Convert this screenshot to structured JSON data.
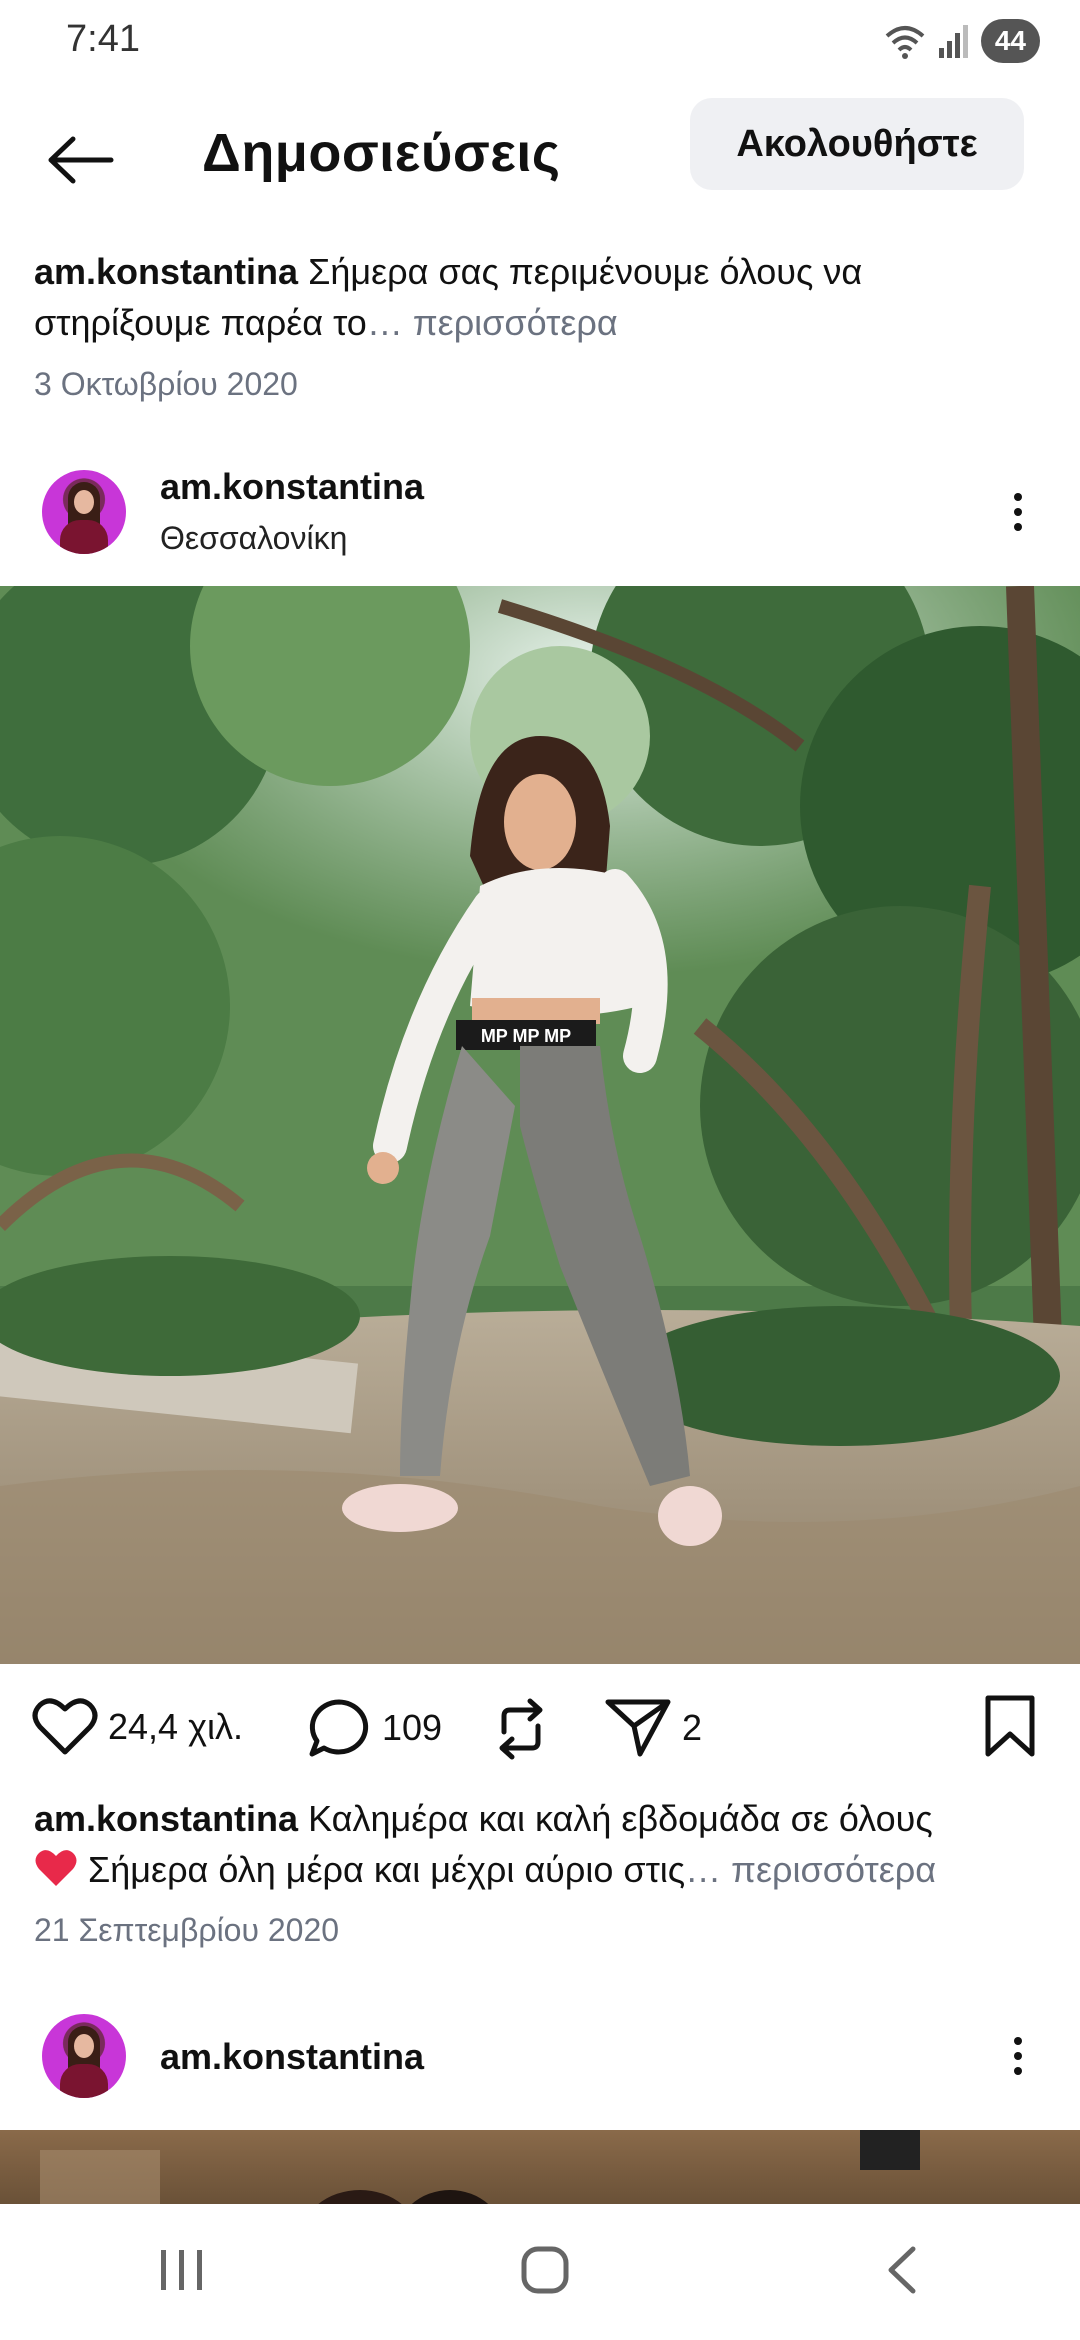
{
  "status_bar": {
    "time": "7:41",
    "battery": "44"
  },
  "header": {
    "title": "Δημοσιεύσεις",
    "follow_label": "Ακολουθήστε"
  },
  "post_prev": {
    "username": "am.konstantina",
    "caption": "Σήμερα σας περιμένουμε όλους να στηρίξουμε παρέα το",
    "more_label": "… περισσότερα",
    "date": "3 Οκτωβρίου 2020"
  },
  "post": {
    "username": "am.konstantina",
    "location": "Θεσσαλονίκη",
    "likes": "24,4 χιλ.",
    "comments": "109",
    "shares": "2",
    "caption_part1": "Καλημέρα και καλή εβδομάδα σε όλους",
    "caption_part2": "Σήμερα όλη μέρα και μέχρι αύριο στις",
    "more_label": "… περισσότερα",
    "date": "21 Σεπτεμβρίου 2020",
    "waistband_text": "MP MP MP"
  },
  "post_next": {
    "username": "am.konstantina"
  },
  "colors": {
    "accent_heart": "#e8294a",
    "muted_text": "#6b7280",
    "follow_bg": "#eff0f3"
  }
}
